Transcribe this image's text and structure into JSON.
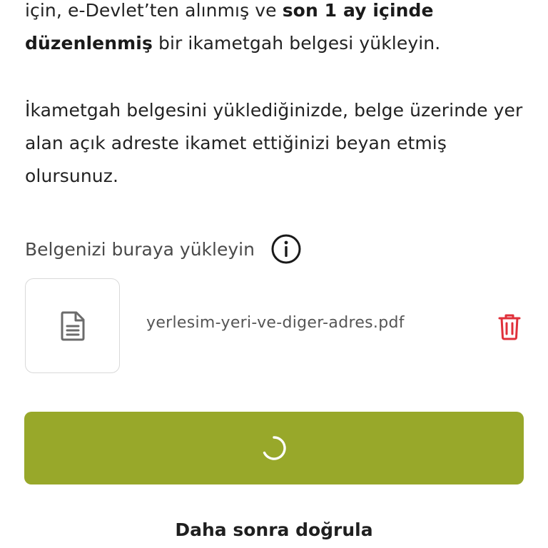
{
  "intro": {
    "line1_pre": "için, e-Devlet’ten alınmış ve ",
    "line1_bold": "son 1 ay içinde",
    "line2_bold": "düzenlenmiş",
    "line2_post": " bir ikametgah belgesi yükleyin."
  },
  "declaration": {
    "text": "İkametgah belgesini yüklediğinizde, belge üzerinde yer alan açık adreste ikamet ettiğinizi beyan etmiş olursunuz."
  },
  "upload": {
    "label": "Belgenizi buraya yükleyin",
    "info_icon": "info-icon",
    "file_icon": "document-icon",
    "file_name": "yerlesim-yeri-ve-diger-adres.pdf",
    "delete_icon": "trash-icon"
  },
  "primary_button": {
    "state": "loading",
    "spinner_icon": "loading-spinner-icon"
  },
  "secondary_action": {
    "label": "Daha sonra doğrula"
  },
  "colors": {
    "primary": "#98a82a",
    "danger": "#e0303a",
    "text": "#222222"
  }
}
